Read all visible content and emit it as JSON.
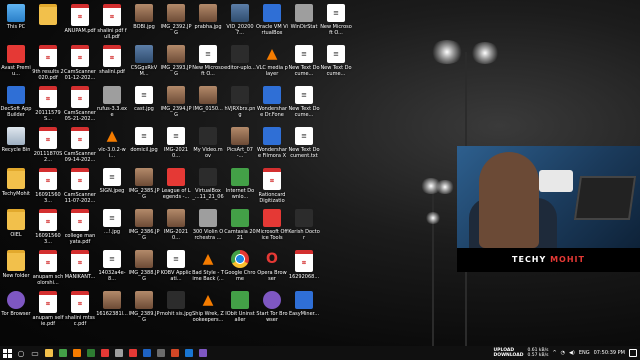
{
  "desktop": {
    "icons": [
      {
        "label": "This PC",
        "icon": "this-pc-icon",
        "kind": "g-pc"
      },
      {
        "label": "",
        "icon": "folder-icon",
        "kind": "g-folder"
      },
      {
        "label": "ANUPAM.pdf",
        "icon": "pdf-icon",
        "kind": "g-pdf"
      },
      {
        "label": "shalini pdf full.pdf",
        "icon": "pdf-icon",
        "kind": "g-pdf"
      },
      {
        "label": "BOBI.jpg",
        "icon": "photo-icon",
        "kind": "g-photo"
      },
      {
        "label": "IMG_2392.JPG",
        "icon": "photo-icon",
        "kind": "g-photo"
      },
      {
        "label": "prabha.jpg",
        "icon": "photo-icon",
        "kind": "g-photo"
      },
      {
        "label": "VID_202007...",
        "icon": "video-icon",
        "kind": "g-img"
      },
      {
        "label": "Oracle VM VirtualBox",
        "icon": "virtualbox-icon",
        "kind": "g-app"
      },
      {
        "label": "WinDirStat",
        "icon": "windirstat-icon",
        "kind": "g-gray"
      },
      {
        "label": "New Microsoft O...",
        "icon": "text-file-icon",
        "kind": "g-txt"
      },
      {
        "label": "Avast Premiu...",
        "icon": "avast-icon",
        "kind": "g-red"
      },
      {
        "label": "9th results 2020.pdf",
        "icon": "pdf-icon",
        "kind": "g-pdf"
      },
      {
        "label": "CamScanner 01-12-202...",
        "icon": "pdf-icon",
        "kind": "g-pdf"
      },
      {
        "label": "shalini.pdf",
        "icon": "pdf-icon",
        "kind": "g-pdf"
      },
      {
        "label": "C5GgxRkVM...",
        "icon": "image-icon",
        "kind": "g-img"
      },
      {
        "label": "IMG_2393.JPG",
        "icon": "photo-icon",
        "kind": "g-photo"
      },
      {
        "label": "New Microsoft O...",
        "icon": "text-file-icon",
        "kind": "g-txt"
      },
      {
        "label": "editor-uplo...",
        "icon": "image-icon",
        "kind": "g-dark"
      },
      {
        "label": "VLC media player",
        "icon": "vlc-icon",
        "kind": "g-vlc"
      },
      {
        "label": "New Text Docume...",
        "icon": "text-file-icon",
        "kind": "g-txt"
      },
      {
        "label": "New Text Docume...",
        "icon": "text-file-icon",
        "kind": "g-txt"
      },
      {
        "label": "DecSoft App Builder",
        "icon": "app-builder-icon",
        "kind": "g-app"
      },
      {
        "label": "20111579S...",
        "icon": "pdf-icon",
        "kind": "g-pdf"
      },
      {
        "label": "CamScanner 05-21-202...",
        "icon": "pdf-icon",
        "kind": "g-pdf"
      },
      {
        "label": "rufus-3.3.exe",
        "icon": "usb-icon",
        "kind": "g-gray"
      },
      {
        "label": "cast.jpg",
        "icon": "image-icon",
        "kind": "g-txt"
      },
      {
        "label": "IMG_2394.JPG",
        "icon": "photo-icon",
        "kind": "g-photo"
      },
      {
        "label": "IMG_0150...",
        "icon": "photo-icon",
        "kind": "g-photo"
      },
      {
        "label": "hVJRXbrx.png",
        "icon": "image-icon",
        "kind": "g-dark"
      },
      {
        "label": "Wondershare Dr.Fone",
        "icon": "drfone-icon",
        "kind": "g-app"
      },
      {
        "label": "New Text Docume...",
        "icon": "text-file-icon",
        "kind": "g-txt"
      },
      {
        "label": "",
        "icon": "blank-icon",
        "kind": ""
      },
      {
        "label": "Recycle Bin",
        "icon": "recycle-bin-icon",
        "kind": "g-bin"
      },
      {
        "label": "20111870S2...",
        "icon": "pdf-icon",
        "kind": "g-pdf"
      },
      {
        "label": "CamScanner 09-14-202...",
        "icon": "pdf-icon",
        "kind": "g-pdf"
      },
      {
        "label": "vlc-3.0.2-wi...",
        "icon": "vlc-icon",
        "kind": "g-vlc"
      },
      {
        "label": "domicil.jpg",
        "icon": "image-icon",
        "kind": "g-txt"
      },
      {
        "label": "IMG-20210...",
        "icon": "image-icon",
        "kind": "g-txt"
      },
      {
        "label": "My Video.mov",
        "icon": "video-icon",
        "kind": "g-dark"
      },
      {
        "label": "PicsArt_07-...",
        "icon": "image-icon",
        "kind": "g-photo"
      },
      {
        "label": "Wondershare Filmora X",
        "icon": "filmora-icon",
        "kind": "g-app"
      },
      {
        "label": "New Text Document.txt",
        "icon": "text-file-icon",
        "kind": "g-txt"
      },
      {
        "label": "",
        "icon": "blank-icon",
        "kind": ""
      },
      {
        "label": "TechyMohit",
        "icon": "folder-icon",
        "kind": "g-folder"
      },
      {
        "label": "160915603...",
        "icon": "pdf-icon",
        "kind": "g-pdf"
      },
      {
        "label": "CamScanner 11-07-202...",
        "icon": "pdf-icon",
        "kind": "g-pdf"
      },
      {
        "label": "SIGN.jpeg",
        "icon": "image-icon",
        "kind": "g-txt"
      },
      {
        "label": "IMG_2385.JPG",
        "icon": "photo-icon",
        "kind": "g-photo"
      },
      {
        "label": "League of Legends -...",
        "icon": "game-icon",
        "kind": "g-red"
      },
      {
        "label": "VirtualBox_...11_21_06_2...",
        "icon": "image-icon",
        "kind": "g-dark"
      },
      {
        "label": "Internet Downlo...",
        "icon": "idm-icon",
        "kind": "g-green"
      },
      {
        "label": "Rationcard Digitization...",
        "icon": "pdf-icon",
        "kind": "g-pdf"
      },
      {
        "label": "",
        "icon": "blank-icon",
        "kind": ""
      },
      {
        "label": "",
        "icon": "blank-icon",
        "kind": ""
      },
      {
        "label": "OIEL",
        "icon": "folder-icon",
        "kind": "g-folder"
      },
      {
        "label": "160915603...",
        "icon": "pdf-icon",
        "kind": "g-pdf"
      },
      {
        "label": "college manyata.pdf",
        "icon": "pdf-icon",
        "kind": "g-pdf"
      },
      {
        "label": "...!.jpg",
        "icon": "image-icon",
        "kind": "g-txt"
      },
      {
        "label": "IMG_2386.JPG",
        "icon": "photo-icon",
        "kind": "g-photo"
      },
      {
        "label": "IMG-20210...",
        "icon": "photo-icon",
        "kind": "g-photo"
      },
      {
        "label": "300 Violin Orchestra ...",
        "icon": "audio-icon",
        "kind": "g-gray"
      },
      {
        "label": "Camtasia 2021",
        "icon": "camtasia-icon",
        "kind": "g-green"
      },
      {
        "label": "Microsoft Office Tools",
        "icon": "office-icon",
        "kind": "g-red"
      },
      {
        "label": "Kerish Doctor",
        "icon": "kerish-icon",
        "kind": "g-dark"
      },
      {
        "label": "",
        "icon": "blank-icon",
        "kind": ""
      },
      {
        "label": "New folder",
        "icon": "folder-icon",
        "kind": "g-folder"
      },
      {
        "label": "anupam scholorshi...",
        "icon": "pdf-icon",
        "kind": "g-pdf"
      },
      {
        "label": "MANIKANT...",
        "icon": "pdf-icon",
        "kind": "g-pdf"
      },
      {
        "label": "14032a4e-8...",
        "icon": "image-icon",
        "kind": "g-txt"
      },
      {
        "label": "IMG_2388.JPG",
        "icon": "photo-icon",
        "kind": "g-photo"
      },
      {
        "label": "KOBV Applicati...",
        "icon": "text-file-icon",
        "kind": "g-txt"
      },
      {
        "label": "Bad Style - Time Back (...",
        "icon": "vlc-icon",
        "kind": "g-vlc"
      },
      {
        "label": "Google Chrome",
        "icon": "chrome-icon",
        "kind": "g-chrome"
      },
      {
        "label": "Opera Browser",
        "icon": "opera-icon",
        "kind": "g-opera"
      },
      {
        "label": "16292068...",
        "icon": "pdf-icon",
        "kind": "g-pdf"
      },
      {
        "label": "",
        "icon": "blank-icon",
        "kind": ""
      },
      {
        "label": "Tor Browser",
        "icon": "tor-icon",
        "kind": "g-tor"
      },
      {
        "label": "anupam selfie.pdf",
        "icon": "pdf-icon",
        "kind": "g-pdf"
      },
      {
        "label": "shalini mtssc.pdf",
        "icon": "pdf-icon",
        "kind": "g-pdf"
      },
      {
        "label": "16162381l...",
        "icon": "image-icon",
        "kind": "g-photo"
      },
      {
        "label": "IMG_2389.JPG",
        "icon": "photo-icon",
        "kind": "g-photo"
      },
      {
        "label": "mohit sis.jpg",
        "icon": "photo-icon",
        "kind": "g-dark"
      },
      {
        "label": "Ship Wrek, Zookeepers...",
        "icon": "vlc-icon",
        "kind": "g-vlc"
      },
      {
        "label": "IObit Uninstaller",
        "icon": "iobit-icon",
        "kind": "g-green"
      },
      {
        "label": "Start Tor Browser",
        "icon": "tor-icon",
        "kind": "g-tor"
      },
      {
        "label": "EasyMiner...",
        "icon": "app-icon",
        "kind": "g-app"
      },
      {
        "label": "",
        "icon": "blank-icon",
        "kind": ""
      }
    ]
  },
  "webcam": {
    "brand_main": "TECHY ",
    "brand_accent": "MOHIT",
    "accent_color": "#e53935"
  },
  "taskbar": {
    "pinned": [
      {
        "icon": "search-icon",
        "glyph": "○"
      },
      {
        "icon": "task-view-icon",
        "glyph": "▭"
      },
      {
        "icon": "file-explorer-icon",
        "color": "#f2c04b"
      },
      {
        "icon": "chrome-icon",
        "color": "#43a047"
      },
      {
        "icon": "vlc-icon",
        "color": "#f57c00"
      },
      {
        "icon": "camtasia-icon",
        "color": "#2e7d32"
      },
      {
        "icon": "opera-icon",
        "color": "#e53935"
      },
      {
        "icon": "settings-icon",
        "color": "#9e9e9e"
      },
      {
        "icon": "recorder-icon",
        "color": "#e53935"
      },
      {
        "icon": "word-icon",
        "color": "#1e63c4"
      },
      {
        "icon": "photos-icon",
        "color": "#6b6b6b"
      },
      {
        "icon": "powerpoint-icon",
        "color": "#d24726"
      },
      {
        "icon": "mail-icon",
        "color": "#1976d2"
      },
      {
        "icon": "app-icon",
        "color": "#7e57c2"
      }
    ],
    "upload_label": "UPLOAD",
    "download_label": "DOWNLOAD",
    "upload_speed": "0.61 kB/s",
    "download_speed": "0.57 kB/s",
    "language": "ENG",
    "time": "07:50:39 PM"
  }
}
